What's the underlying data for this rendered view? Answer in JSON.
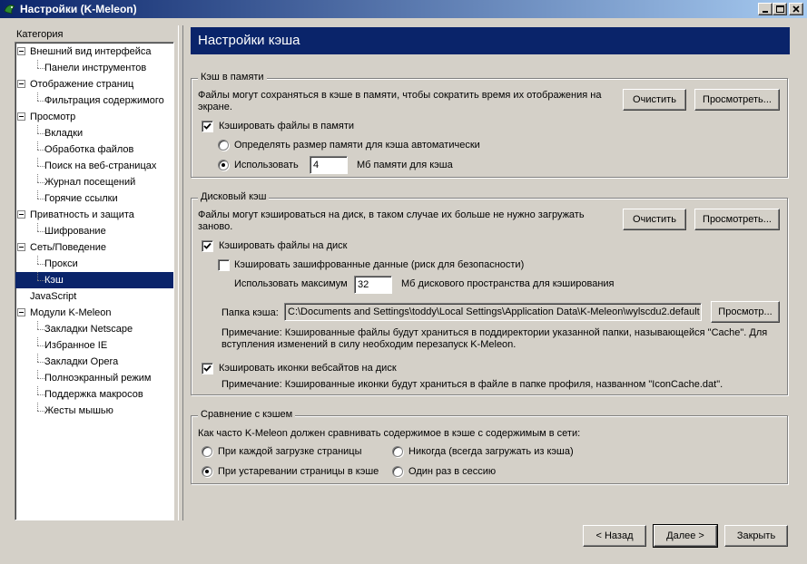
{
  "window": {
    "title": "Настройки (K-Meleon)"
  },
  "category_label": "Категория",
  "tree": [
    {
      "label": "Внешний вид интерфейса",
      "level": 0,
      "expanded": true
    },
    {
      "label": "Панели инструментов",
      "level": 1
    },
    {
      "label": "Отображение страниц",
      "level": 0,
      "expanded": true
    },
    {
      "label": "Фильтрация содержимого",
      "level": 1
    },
    {
      "label": "Просмотр",
      "level": 0,
      "expanded": true
    },
    {
      "label": "Вкладки",
      "level": 1
    },
    {
      "label": "Обработка файлов",
      "level": 1
    },
    {
      "label": "Поиск на веб-страницах",
      "level": 1
    },
    {
      "label": "Журнал посещений",
      "level": 1
    },
    {
      "label": "Горячие ссылки",
      "level": 1
    },
    {
      "label": "Приватность и защита",
      "level": 0,
      "expanded": true
    },
    {
      "label": "Шифрование",
      "level": 1
    },
    {
      "label": "Сеть/Поведение",
      "level": 0,
      "expanded": true
    },
    {
      "label": "Прокси",
      "level": 1
    },
    {
      "label": "Кэш",
      "level": 1,
      "selected": true
    },
    {
      "label": "JavaScript",
      "level": 0
    },
    {
      "label": "Модули K-Meleon",
      "level": 0,
      "expanded": true
    },
    {
      "label": "Закладки Netscape",
      "level": 1
    },
    {
      "label": "Избранное IE",
      "level": 1
    },
    {
      "label": "Закладки Opera",
      "level": 1
    },
    {
      "label": "Полноэкранный режим",
      "level": 1
    },
    {
      "label": "Поддержка макросов",
      "level": 1
    },
    {
      "label": "Жесты мышью",
      "level": 1
    }
  ],
  "header": {
    "title": "Настройки кэша"
  },
  "memory_cache": {
    "legend": "Кэш в памяти",
    "description": "Файлы могут сохраняться в кэше в памяти, чтобы сократить время их отображения на экране.",
    "clear_label": "Очистить",
    "view_label": "Просмотреть...",
    "enable_label": "Кэшировать файлы в памяти",
    "enable_checked": true,
    "auto_label": "Определять размер памяти для кэша автоматически",
    "auto_selected": false,
    "use_label": "Использовать",
    "use_selected": true,
    "size_value": "4",
    "size_suffix": "Мб памяти для кэша"
  },
  "disk_cache": {
    "legend": "Дисковый кэш",
    "description": "Файлы могут кэшироваться на диск, в таком случае их больше не нужно загружать заново.",
    "clear_label": "Очистить",
    "view_label": "Просмотреть...",
    "enable_label": "Кэшировать файлы на диск",
    "enable_checked": true,
    "encrypted_label": "Кэшировать зашифрованные данные (риск для безопасности)",
    "encrypted_checked": false,
    "max_label": "Использовать максимум",
    "max_value": "32",
    "max_suffix": "Мб дискового пространства для кэширования",
    "folder_label": "Папка кэша:",
    "folder_value": "C:\\Documents and Settings\\toddy\\Local Settings\\Application Data\\K-Meleon\\wylscdu2.default",
    "browse_label": "Просмотр...",
    "folder_note": "Примечание: Кэшированные файлы будут храниться в поддиректории указанной папки, называющейся \"Cache\". Для вступления изменений в силу необходим перезапуск K-Meleon.",
    "icons_label": "Кэшировать иконки вебсайтов на диск",
    "icons_checked": true,
    "icons_note": "Примечание: Кэшированные иконки будут храниться в файле в папке профиля, названном \"IconCache.dat\"."
  },
  "compare": {
    "legend": "Сравнение с кэшем",
    "question": "Как часто K-Meleon должен сравнивать содержимое в кэше с содержимым в сети:",
    "options": [
      {
        "label": "При каждой загрузке страницы",
        "selected": false
      },
      {
        "label": "Никогда (всегда загружать из кэша)",
        "selected": false
      },
      {
        "label": "При устаревании страницы в кэше",
        "selected": true
      },
      {
        "label": "Один раз в сессию",
        "selected": false
      }
    ]
  },
  "footer": {
    "back_label": "< Назад",
    "next_label": "Далее >",
    "close_label": "Закрыть"
  }
}
